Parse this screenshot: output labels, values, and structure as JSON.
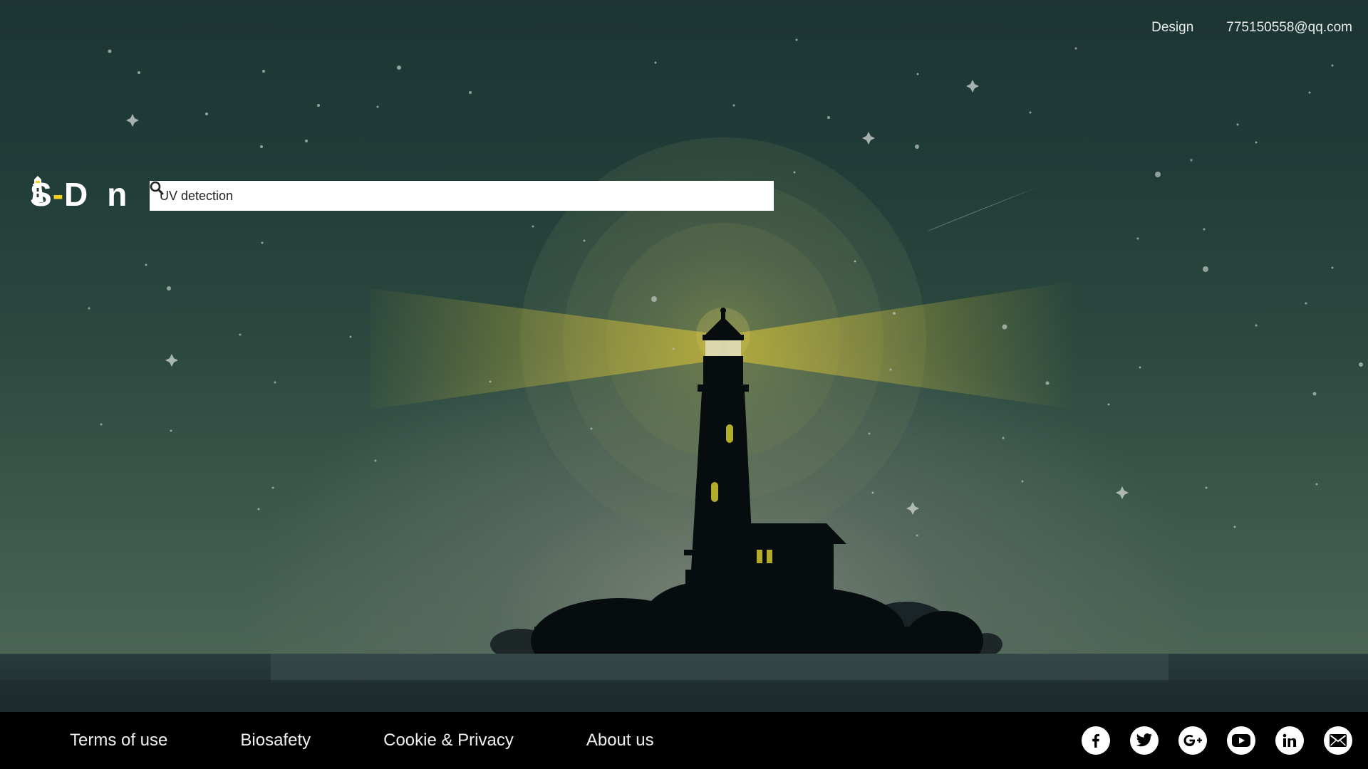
{
  "nav": {
    "design_label": "Design",
    "email_label": "775150558@qq.com"
  },
  "logo": {
    "part1": "S",
    "dash": "-",
    "part2": "D",
    "part3": "n"
  },
  "search": {
    "value": "UV detection",
    "icon": "search-icon"
  },
  "footer": {
    "links": [
      {
        "label": "Terms of use"
      },
      {
        "label": "Biosafety"
      },
      {
        "label": "Cookie & Privacy"
      },
      {
        "label": "About us"
      }
    ],
    "social": [
      {
        "icon": "facebook-icon"
      },
      {
        "icon": "twitter-icon"
      },
      {
        "icon": "google-plus-icon"
      },
      {
        "icon": "youtube-icon"
      },
      {
        "icon": "linkedin-icon"
      },
      {
        "icon": "email-icon"
      }
    ]
  },
  "colors": {
    "accent": "#f2d01c",
    "footer_bg": "#000000",
    "window_light": "#c9bf2a"
  }
}
